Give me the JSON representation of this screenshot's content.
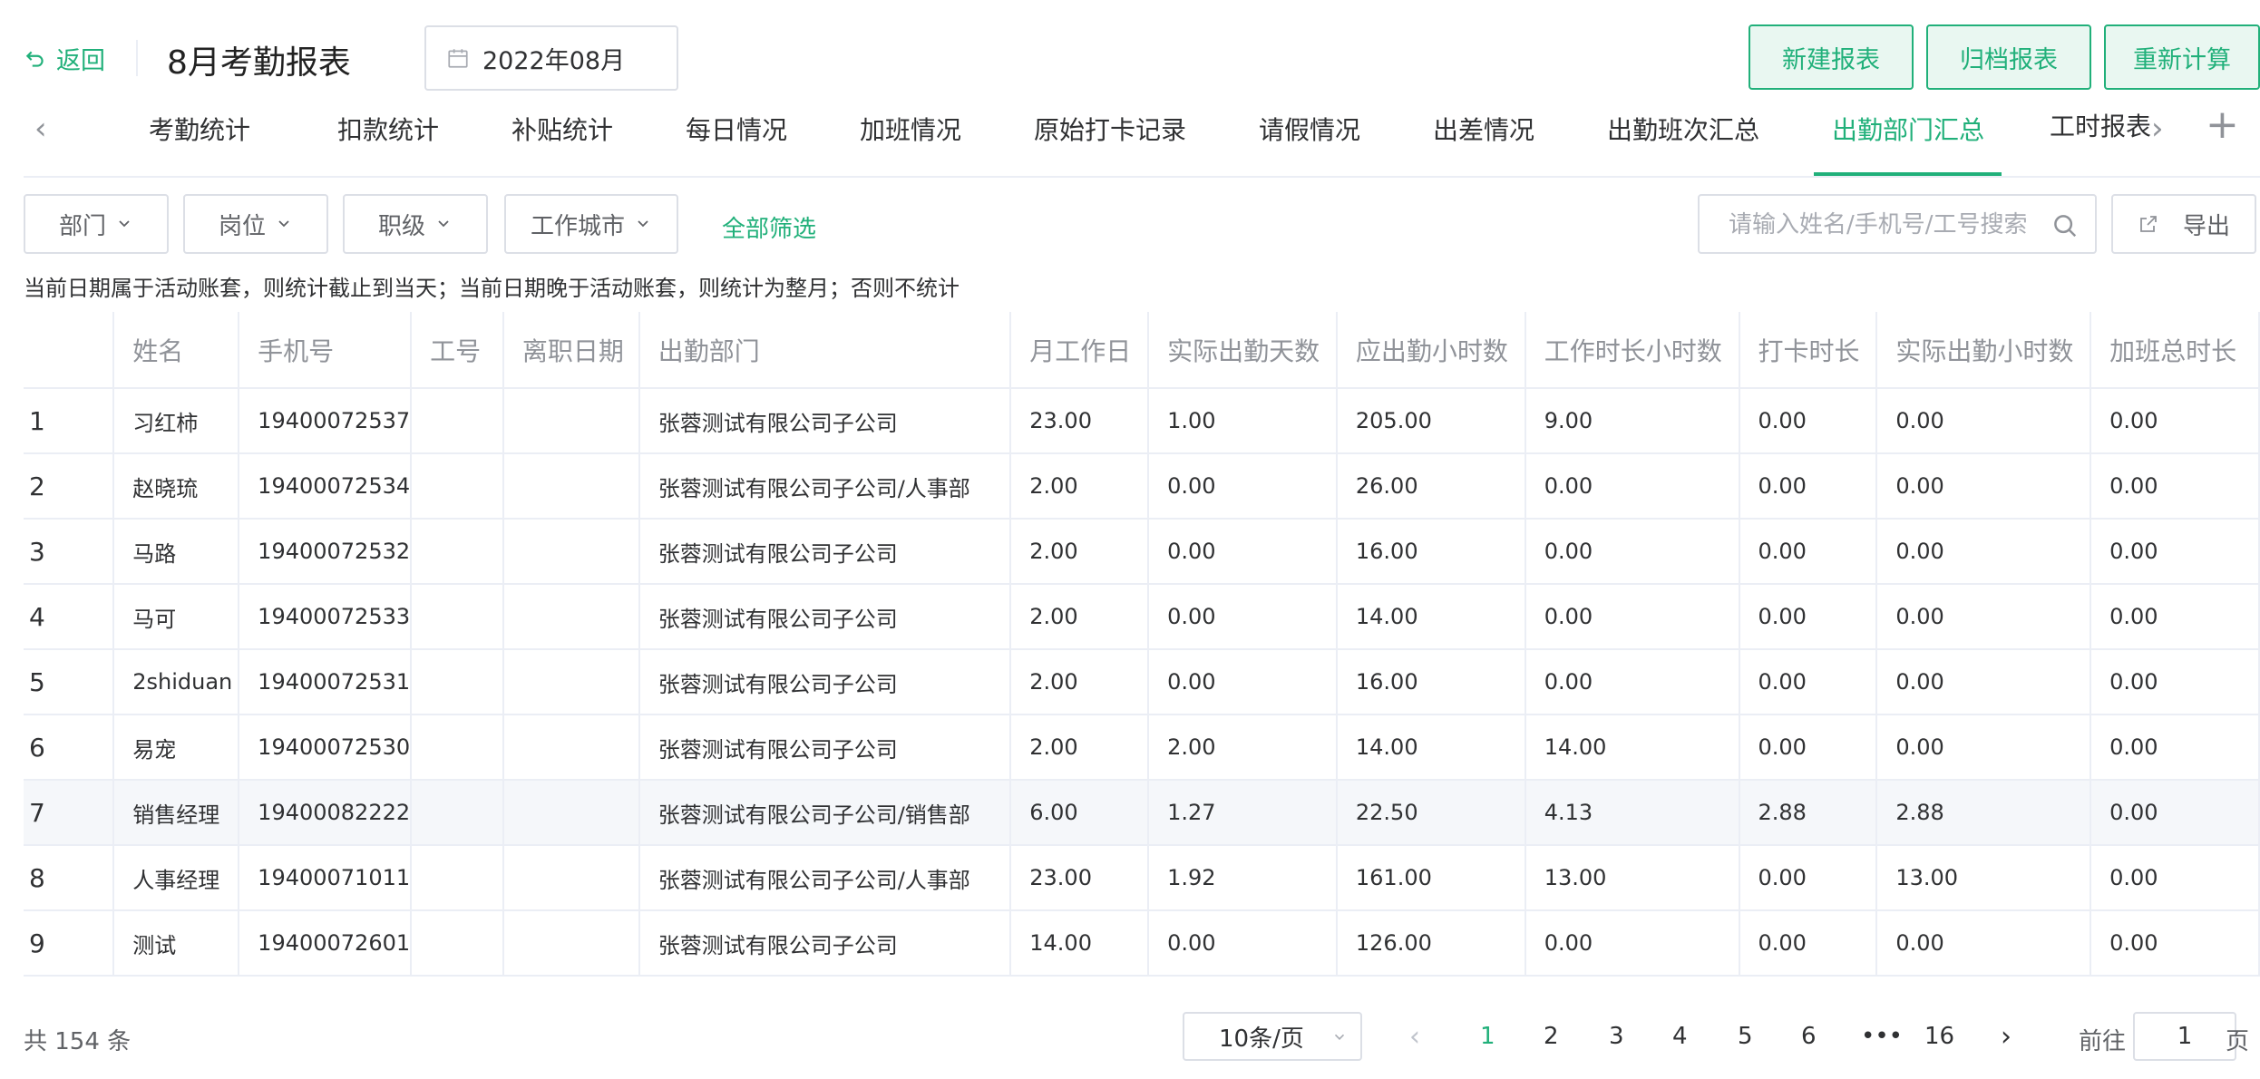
{
  "header": {
    "back_label": "返回",
    "title": "8月考勤报表",
    "date": "2022年08月",
    "buttons": [
      "新建报表",
      "归档报表",
      "重新计算"
    ]
  },
  "tabs": {
    "items": [
      "考勤统计",
      "扣款统计",
      "补贴统计",
      "每日情况",
      "加班情况",
      "原始打卡记录",
      "请假情况",
      "出差情况",
      "出勤班次汇总",
      "出勤部门汇总"
    ],
    "active": "出勤部门汇总",
    "clipped_item": "工时报表"
  },
  "filters": {
    "dropdowns": [
      "部门",
      "岗位",
      "职级",
      "工作城市"
    ],
    "all_filter": "全部筛选",
    "search_placeholder": "请输入姓名/手机号/工号搜索",
    "export_label": "导出"
  },
  "notice": "当前日期属于活动账套，则统计截止到当天；当前日期晚于活动账套，则统计为整月；否则不统计",
  "table": {
    "columns": [
      "",
      "姓名",
      "手机号",
      "工号",
      "离职日期",
      "出勤部门",
      "月工作日",
      "实际出勤天数",
      "应出勤小时数",
      "工作时长小时数",
      "打卡时长",
      "实际出勤小时数",
      "加班总时长"
    ],
    "rows": [
      [
        "1",
        "习红柿",
        "19400072537",
        "",
        "",
        "张蓉测试有限公司子公司",
        "23.00",
        "1.00",
        "205.00",
        "9.00",
        "0.00",
        "0.00",
        "0.00"
      ],
      [
        "2",
        "赵晓琉",
        "19400072534",
        "",
        "",
        "张蓉测试有限公司子公司/人事部",
        "2.00",
        "0.00",
        "26.00",
        "0.00",
        "0.00",
        "0.00",
        "0.00"
      ],
      [
        "3",
        "马路",
        "19400072532",
        "",
        "",
        "张蓉测试有限公司子公司",
        "2.00",
        "0.00",
        "16.00",
        "0.00",
        "0.00",
        "0.00",
        "0.00"
      ],
      [
        "4",
        "马可",
        "19400072533",
        "",
        "",
        "张蓉测试有限公司子公司",
        "2.00",
        "0.00",
        "14.00",
        "0.00",
        "0.00",
        "0.00",
        "0.00"
      ],
      [
        "5",
        "2shiduan",
        "19400072531",
        "",
        "",
        "张蓉测试有限公司子公司",
        "2.00",
        "0.00",
        "16.00",
        "0.00",
        "0.00",
        "0.00",
        "0.00"
      ],
      [
        "6",
        "易宠",
        "19400072530",
        "",
        "",
        "张蓉测试有限公司子公司",
        "2.00",
        "2.00",
        "14.00",
        "14.00",
        "0.00",
        "0.00",
        "0.00"
      ],
      [
        "7",
        "销售经理",
        "19400082222",
        "",
        "",
        "张蓉测试有限公司子公司/销售部",
        "6.00",
        "1.27",
        "22.50",
        "4.13",
        "2.88",
        "2.88",
        "0.00"
      ],
      [
        "8",
        "人事经理",
        "19400071011",
        "",
        "",
        "张蓉测试有限公司子公司/人事部",
        "23.00",
        "1.92",
        "161.00",
        "13.00",
        "0.00",
        "13.00",
        "0.00"
      ],
      [
        "9",
        "测试",
        "19400072601",
        "",
        "",
        "张蓉测试有限公司子公司",
        "14.00",
        "0.00",
        "126.00",
        "0.00",
        "0.00",
        "0.00",
        "0.00"
      ]
    ],
    "highlighted_row": 7
  },
  "pagination": {
    "total": "共 154 条",
    "page_size": "10条/页",
    "pages": [
      "1",
      "2",
      "3",
      "4",
      "5",
      "6",
      "•••",
      "16"
    ],
    "current": "1",
    "goto_label": "前往",
    "goto_value": "1",
    "goto_suffix": "页"
  },
  "colors": {
    "accent": "#21b07a",
    "accent_bg": "#e9f7f1",
    "border": "#dcdfe6",
    "row_highlight": "#f5f7fa"
  }
}
